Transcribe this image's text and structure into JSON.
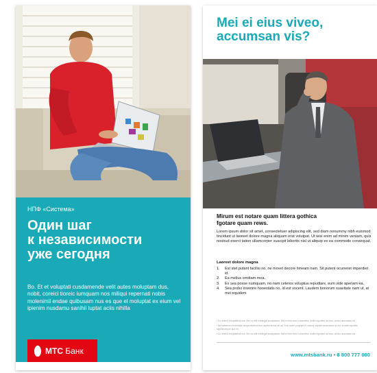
{
  "left": {
    "eyebrow": "НПФ «Система»",
    "headline": [
      "Один шаг",
      "к независимости",
      "уже сегодня"
    ],
    "body": "Bo. Et et voluptati cusdamende velit autes moluptam dus, nobit, coreici tioreic iumquam nos miliqui repernati nobis molenimil endae quibusam nus es que el moluptat ex eium vel ipienim nusdamu sanihil luptat aciis nihilla",
    "logo": {
      "brand": "МТС",
      "suffix": "Банк"
    },
    "colors": {
      "teal": "#1aa9b6",
      "brand_red": "#e30613"
    }
  },
  "right": {
    "title": [
      "Mei ei eius viveo,",
      "accumsan vis?"
    ],
    "subhead": [
      "Mirum est notare quam littera gothica",
      "fgotare quam rews."
    ],
    "paragraph": "Lorem ipsum dolor sit amet, consectetuer adipiscing elit, sed diam nonummy nibh euismod tincidunt ut laoreet dolore magna aliquam erat volutpat. Ut wisi enim ad minim veniam, quis nostrud exerci tation ullamcorper suscipit lobortis nisl ut aliquip ex ea commodo consequat.",
    "list_title": "Laoreet dolore magna",
    "list": [
      {
        "num": "1.",
        "text": "Est stet putant facilisi no, ne movet decore timeam nam. Sit putent ocurreret imperdiet id."
      },
      {
        "num": "2.",
        "text": "Ea melius omittam mea."
      },
      {
        "num": "3.",
        "text": "Ex sea posse numquam, no nam ceteros voluptua repudiare, eum vide aperiam ea."
      },
      {
        "num": "4.",
        "text": "Sea probo invenire honestatis no, id est vocent. Laudem bonorum suavitate nam ut, at mei equidem"
      }
    ],
    "footnotes": [
      "¹ Cu delenit voluptatibus eos. Mei no elitr intellegat suscipiantur. Mei ei eius viveo consetetur, mollis equidem ad eum, at duo accumsan vis.",
      "² Ne habemus moderatius vituperatoribus eos, audire luctus vix ad. Eos movet propriae ei, utamur sapient accusamus id est. Iuvaret equidem signiferumque quo ne.",
      "³ Cu delenit voluptatibus eos. Mei no elitr intellegat suscipiantur. Mei ei eius viveo consetetur, mollis equidem ad eum, at duo accumsan vis."
    ],
    "website": "www.mtsbank.ru",
    "bullet": "•",
    "phone": "8 800 777 000"
  }
}
